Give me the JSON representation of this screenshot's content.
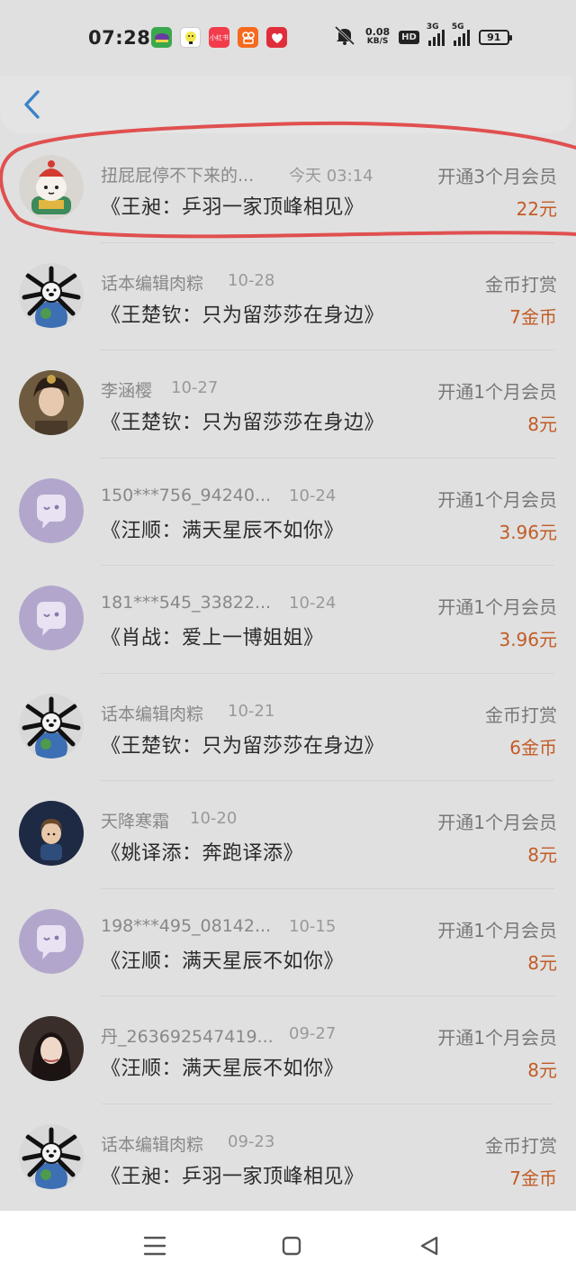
{
  "status_bar": {
    "time": "07:28",
    "app_icons": [
      {
        "name": "game-app-icon",
        "color": "#3aa84c",
        "text": ""
      },
      {
        "name": "qq-mini-icon",
        "color": "#f2e84a",
        "text": ""
      },
      {
        "name": "xiaohongshu-icon",
        "color": "#f23c4c",
        "text": "小红书"
      },
      {
        "name": "kuaishou-icon",
        "color": "#f56a1e",
        "text": ""
      },
      {
        "name": "pinduoduo-icon",
        "color": "#e02e3a",
        "text": ""
      }
    ],
    "net_speed_value": "0.08",
    "net_speed_unit": "KB/S",
    "hd_label": "HD",
    "signal1_label": "3G",
    "signal2_label": "5G",
    "battery": "91"
  },
  "header": {
    "back_icon": "chevron-left-icon"
  },
  "records": [
    {
      "name": "扭屁屁停不下来的...",
      "date": "今天 03:14",
      "title": "《王昶：乒羽一家顶峰相见》",
      "type": "开通3个月会员",
      "amount": "22元",
      "avatar": "cartoon"
    },
    {
      "name": "话本编辑肉粽",
      "date": "10-28",
      "title": "《王楚钦：只为留莎莎在身边》",
      "type": "金币打赏",
      "amount": "7金币",
      "avatar": "dog"
    },
    {
      "name": "李涵樱",
      "date": "10-27",
      "title": "《王楚钦：只为留莎莎在身边》",
      "type": "开通1个月会员",
      "amount": "8元",
      "avatar": "photo-woman"
    },
    {
      "name": "150***756_94240...",
      "date": "10-24",
      "title": "《汪顺：满天星辰不如你》",
      "type": "开通1个月会员",
      "amount": "3.96元",
      "avatar": "default"
    },
    {
      "name": "181***545_33822...",
      "date": "10-24",
      "title": "《肖战：爱上一博姐姐》",
      "type": "开通1个月会员",
      "amount": "3.96元",
      "avatar": "default"
    },
    {
      "name": "话本编辑肉粽",
      "date": "10-21",
      "title": "《王楚钦：只为留莎莎在身边》",
      "type": "金币打赏",
      "amount": "6金币",
      "avatar": "dog"
    },
    {
      "name": "天降寒霜",
      "date": "10-20",
      "title": "《姚译添：奔跑译添》",
      "type": "开通1个月会员",
      "amount": "8元",
      "avatar": "photo-boy"
    },
    {
      "name": "198***495_08142...",
      "date": "10-15",
      "title": "《汪顺：满天星辰不如你》",
      "type": "开通1个月会员",
      "amount": "8元",
      "avatar": "default"
    },
    {
      "name": "丹_263692547419...",
      "date": "09-27",
      "title": "《汪顺：满天星辰不如你》",
      "type": "开通1个月会员",
      "amount": "8元",
      "avatar": "photo-girl"
    },
    {
      "name": "话本编辑肉粽",
      "date": "09-23",
      "title": "《王昶：乒羽一家顶峰相见》",
      "type": "金币打赏",
      "amount": "7金币",
      "avatar": "dog"
    }
  ],
  "colors": {
    "amount": "#c25c26",
    "annotation": "#e05050",
    "default_avatar": "#b3a6cc"
  },
  "nav": {
    "menu_icon": "menu-icon",
    "home_icon": "square-home-icon",
    "back_icon": "triangle-back-icon"
  }
}
